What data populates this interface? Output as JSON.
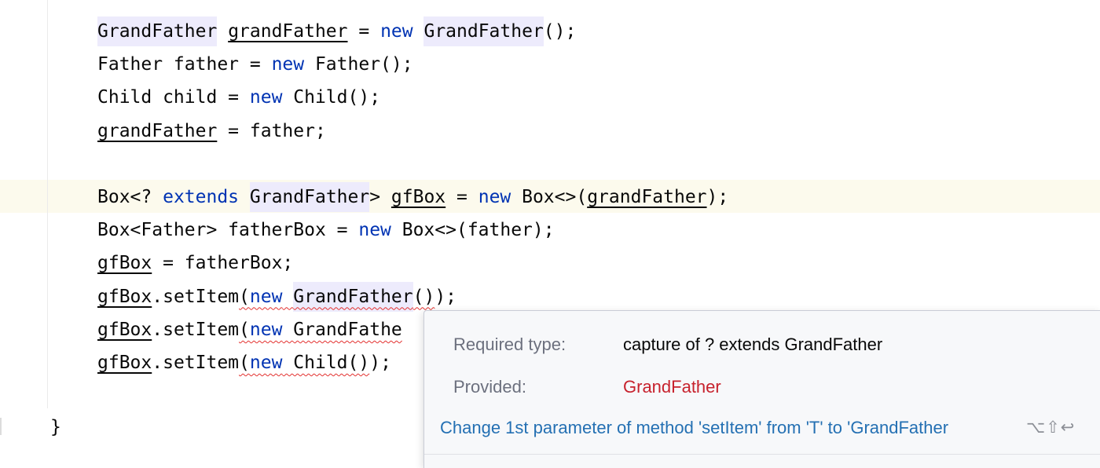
{
  "editor": {
    "lines": [
      [
        {
          "t": "GrandFather",
          "c": "hl"
        },
        {
          "t": " "
        },
        {
          "t": "grandFather",
          "c": "ul"
        },
        {
          "t": " = "
        },
        {
          "t": "new",
          "c": "kw"
        },
        {
          "t": " "
        },
        {
          "t": "GrandFather",
          "c": "hl"
        },
        {
          "t": "();"
        }
      ],
      [
        {
          "t": "Father father = "
        },
        {
          "t": "new",
          "c": "kw"
        },
        {
          "t": " Father();"
        }
      ],
      [
        {
          "t": "Child child = "
        },
        {
          "t": "new",
          "c": "kw"
        },
        {
          "t": " Child();"
        }
      ],
      [
        {
          "t": "grandFather",
          "c": "ul"
        },
        {
          "t": " = father;"
        }
      ],
      [],
      [
        {
          "t": "Box<? "
        },
        {
          "t": "extends",
          "c": "kw"
        },
        {
          "t": " "
        },
        {
          "t": "GrandFather",
          "c": "hl"
        },
        {
          "t": "> "
        },
        {
          "t": "gfBox",
          "c": "ul"
        },
        {
          "t": " = "
        },
        {
          "t": "new",
          "c": "kw"
        },
        {
          "t": " Box<>("
        },
        {
          "t": "grandFather",
          "c": "ul"
        },
        {
          "t": ");"
        }
      ],
      [
        {
          "t": "Box<Father> fatherBox = "
        },
        {
          "t": "new",
          "c": "kw"
        },
        {
          "t": " Box<>(father);"
        }
      ],
      [
        {
          "t": "gfBox",
          "c": "ul"
        },
        {
          "t": " = fatherBox;"
        }
      ],
      [
        {
          "t": "gfBox",
          "c": "ul"
        },
        {
          "t": ".setItem"
        },
        {
          "t": "(",
          "c": "err"
        },
        {
          "t": "new",
          "c": "kw err"
        },
        {
          "t": " ",
          "c": "err"
        },
        {
          "t": "GrandFather",
          "c": "hl err"
        },
        {
          "t": "()",
          "c": "err"
        },
        {
          "t": ");"
        }
      ],
      [
        {
          "t": "gfBox",
          "c": "ul"
        },
        {
          "t": ".setItem"
        },
        {
          "t": "(",
          "c": "err"
        },
        {
          "t": "new",
          "c": "kw err"
        },
        {
          "t": " ",
          "c": "err"
        },
        {
          "t": "GrandFathe",
          "c": "err"
        }
      ],
      [
        {
          "t": "gfBox",
          "c": "ul"
        },
        {
          "t": ".setItem"
        },
        {
          "t": "(",
          "c": "err"
        },
        {
          "t": "new",
          "c": "kw err"
        },
        {
          "t": " Child()",
          "c": "err"
        },
        {
          "t": ");"
        }
      ]
    ],
    "closing_brace": "}"
  },
  "popup": {
    "required_label": "Required type:",
    "required_value": "capture of ? extends GrandFather",
    "provided_label": "Provided:",
    "provided_value": "GrandFather",
    "quick_fix": "Change 1st parameter of method 'setItem' from 'T' to 'GrandFather",
    "shortcut": "⌥⇧↩"
  },
  "colors": {
    "keyword": "#0033b3",
    "identifier_highlight": "#edebfc",
    "error_wave": "#e3312f",
    "error_text": "#c7222d",
    "link": "#2470b3"
  }
}
